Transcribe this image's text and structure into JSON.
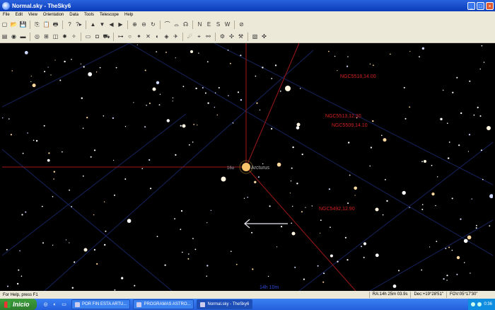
{
  "window": {
    "title": "Normal.sky - TheSky6",
    "minimize": "_",
    "maximize": "□",
    "close": "×"
  },
  "menu": [
    "File",
    "Edit",
    "View",
    "Orientation",
    "Data",
    "Tools",
    "Telescope",
    "Help"
  ],
  "toolbar1_icons": [
    "new-icon",
    "open-icon",
    "save-icon",
    "copy-icon",
    "paste-icon",
    "print-icon",
    "help-icon",
    "context-help-icon",
    "up-arrow-icon",
    "down-arrow-icon",
    "left-arrow-icon",
    "right-arrow-icon",
    "zoom-in-icon",
    "zoom-out-icon",
    "rotate-icon",
    "telescope-icon",
    "horizon-icon",
    "mount-icon",
    "north-icon",
    "east-icon",
    "south-icon",
    "west-icon",
    "find-icon"
  ],
  "toolbar1_glyphs": [
    "▢",
    "📂",
    "💾",
    "⎘",
    "📋",
    "🖶",
    "?",
    "?▸",
    "▲",
    "▼",
    "◀",
    "▶",
    "⊕",
    "⊖",
    "↻",
    "⌒",
    "⌓",
    "☊",
    "N",
    "E",
    "S",
    "W",
    "⊘"
  ],
  "toolbar2_icons": [
    "book-icon",
    "eye-icon",
    "landscape-icon",
    "planet-icon",
    "grid-icon",
    "chart-icon",
    "deep-sky-icon",
    "constellation-icon",
    "folder-icon",
    "camera-icon",
    "car-icon",
    "binoculars-icon",
    "circle-icon",
    "star-icon",
    "scope-icon",
    "lens-icon",
    "filter-icon",
    "tour-icon",
    "comet-icon",
    "mouse-icon",
    "link-icon",
    "robot-icon",
    "satellite-icon",
    "settings-icon",
    "field-icon",
    "crosshair-icon"
  ],
  "toolbar2_glyphs": [
    "▤",
    "◉",
    "▬",
    "◎",
    "⊞",
    "◫",
    "✸",
    "✧",
    "▭",
    "◘",
    "⛟",
    "⊶",
    "○",
    "✦",
    "✕",
    "◐",
    "◈",
    "✈",
    "☄",
    "⌖",
    "⚯",
    "⚙",
    "✣",
    "⚒",
    "▧",
    "✜"
  ],
  "sky": {
    "labels": {
      "arcturus": "Arcturus",
      "alpha_boo": "16α",
      "ngc5518": "NGC5518,14.00",
      "ngc5513": "NGC5513,12.30",
      "ngc5509": "NGC5509,14.10",
      "ngc5492": "NGC5492,12.90",
      "meridian": "14h 10m"
    },
    "colors": {
      "label": "#d42020",
      "line": "#b22222",
      "grid": "#1a2a6a",
      "meridian": "#2040c0"
    }
  },
  "status": {
    "help": "For Help, press F1",
    "ra": "RA:14h 25m 03.9s",
    "dec": "Dec:+19°28'51\"",
    "fov": "FOV:05°17'30\""
  },
  "taskbar": {
    "start": "Inicio",
    "tasks": [
      "POR FIN ESTA ARTU...",
      "PROGRAMAS ASTRO...",
      "Normal.sky - TheSky6"
    ],
    "clock": "0:36"
  }
}
